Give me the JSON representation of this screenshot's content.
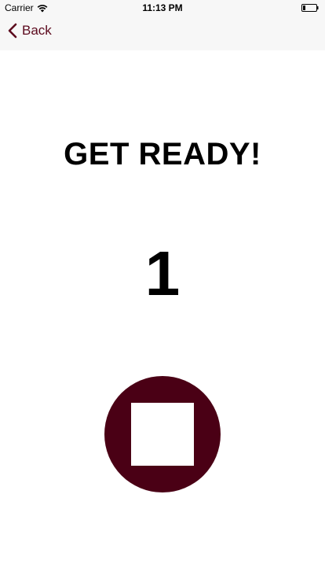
{
  "status_bar": {
    "carrier": "Carrier",
    "time": "11:13 PM",
    "battery_level": 0.15
  },
  "nav": {
    "back_label": "Back",
    "accent_color": "#5c0a1e"
  },
  "main": {
    "title": "GET READY!",
    "countdown": "1",
    "stop_button_color": "#4a0015",
    "stop_icon": "stop-square-icon"
  }
}
